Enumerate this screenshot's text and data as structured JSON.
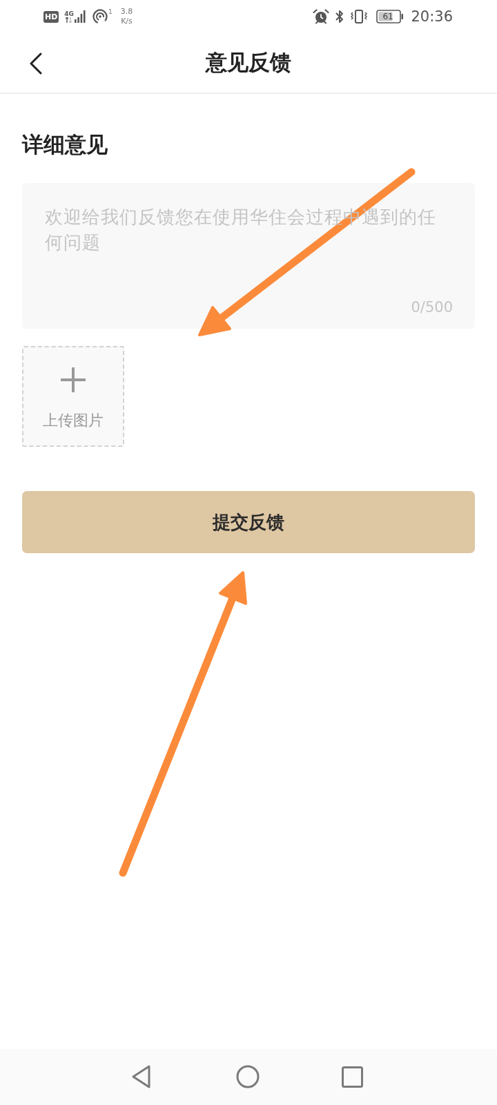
{
  "status_bar": {
    "hd_badge": "HD",
    "network_type": "4G",
    "hotspot_count": "1",
    "speed_value": "3.8",
    "speed_unit": "K/s",
    "battery": "61",
    "time": "20:36"
  },
  "header": {
    "title": "意见反馈"
  },
  "feedback": {
    "heading": "详细意见",
    "placeholder": "欢迎给我们反馈您在使用华住会过程中遇到的任何问题",
    "counter": "0/500"
  },
  "upload": {
    "label": "上传图片"
  },
  "submit_button": {
    "label": "提交反馈"
  }
}
